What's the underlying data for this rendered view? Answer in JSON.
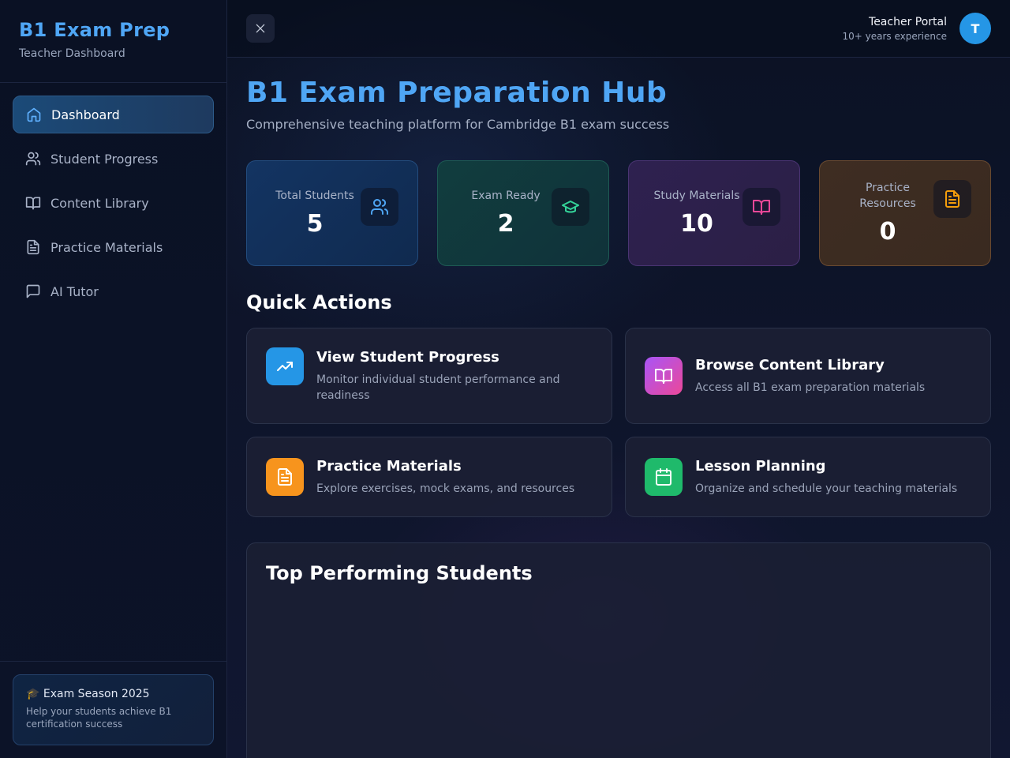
{
  "sidebar": {
    "title": "B1 Exam Prep",
    "subtitle": "Teacher Dashboard",
    "items": [
      {
        "label": "Dashboard",
        "icon": "home-icon",
        "active": true
      },
      {
        "label": "Student Progress",
        "icon": "users-icon"
      },
      {
        "label": "Content Library",
        "icon": "book-open-icon"
      },
      {
        "label": "Practice Materials",
        "icon": "file-text-icon"
      },
      {
        "label": "AI Tutor",
        "icon": "message-square-icon"
      }
    ],
    "promo": {
      "title": "🎓 Exam Season 2025",
      "text": "Help your students achieve B1 certification success"
    }
  },
  "header": {
    "close_icon": "close-icon",
    "user_name": "Teacher Portal",
    "user_experience": "10+ years experience",
    "avatar_initial": "T"
  },
  "main": {
    "title": "B1 Exam Preparation Hub",
    "subtitle": "Comprehensive teaching platform for Cambridge B1 exam success",
    "stats": [
      {
        "label": "Total Students",
        "value": "5",
        "icon": "users-icon",
        "color": "#4fa6f5"
      },
      {
        "label": "Exam Ready",
        "value": "2",
        "icon": "graduation-cap-icon",
        "color": "#34d399"
      },
      {
        "label": "Study Materials",
        "value": "10",
        "icon": "book-open-icon",
        "color": "#ec4899"
      },
      {
        "label": "Practice Resources",
        "value": "0",
        "icon": "file-text-icon",
        "color": "#f59e0b"
      }
    ],
    "quick_actions_title": "Quick Actions",
    "actions": [
      {
        "title": "View Student Progress",
        "desc": "Monitor individual student performance and readiness",
        "icon": "trending-up-icon",
        "color": "#2596e6"
      },
      {
        "title": "Browse Content Library",
        "desc": "Access all B1 exam preparation materials",
        "icon": "book-open-icon",
        "color": "#c04fd8"
      },
      {
        "title": "Practice Materials",
        "desc": "Explore exercises, mock exams, and resources",
        "icon": "file-text-icon",
        "color": "#f7941d"
      },
      {
        "title": "Lesson Planning",
        "desc": "Organize and schedule your teaching materials",
        "icon": "calendar-icon",
        "color": "#1fba6b"
      }
    ],
    "top_students_title": "Top Performing Students"
  }
}
